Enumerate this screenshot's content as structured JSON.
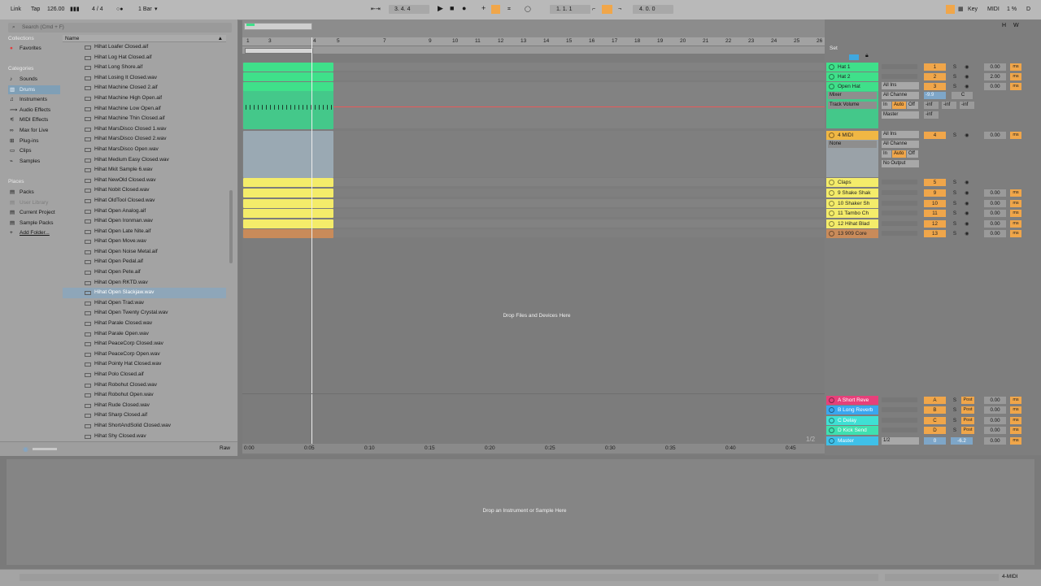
{
  "transport": {
    "link": "Link",
    "tap": "Tap",
    "tempo": "126.00",
    "signature": "4 / 4",
    "quantize": "1 Bar",
    "position": "3.   4.   4",
    "loop_start": "1.   1.   1",
    "loop_length": "4.   0.   0",
    "key_label": "Key",
    "midi_label": "MIDI",
    "cpu": "1 %",
    "disk": "D"
  },
  "browser": {
    "search_placeholder": "Search (Cmd + F)",
    "collections_header": "Collections",
    "favorites": "Favorites",
    "categories_header": "Categories",
    "categories": [
      "Sounds",
      "Drums",
      "Instruments",
      "Audio Effects",
      "MIDI Effects",
      "Max for Live",
      "Plug-ins",
      "Clips",
      "Samples"
    ],
    "selected_category": "Drums",
    "places_header": "Places",
    "places": [
      "Packs",
      "User Library",
      "Current Project",
      "Sample Packs",
      "Add Folder..."
    ],
    "name_column": "Name",
    "files": [
      "Hihat Loafer Closed.aif",
      "Hihat Log Hat Closed.aif",
      "Hihat Long Shore.aif",
      "Hihat Losing It Closed.wav",
      "Hihat Machine Closed 2.aif",
      "Hihat Machine High Open.aif",
      "Hihat Machine Low Open.aif",
      "Hihat Machine Thin Closed.aif",
      "Hihat MarsDisco Closed 1.wav",
      "Hihat MarsDisco Closed 2.wav",
      "Hihat MarsDisco Open.wav",
      "Hihat Medium Easy Closed.wav",
      "Hihat Mkit Sample 6.wav",
      "Hihat NewOld Closed.wav",
      "Hihat Nobit Closed.wav",
      "Hihat OldTool Closed.wav",
      "Hihat Open Analog.aif",
      "Hihat Open Ironman.wav",
      "Hihat Open Late Nite.aif",
      "Hihat Open Move.wav",
      "Hihat Open Noise Metal.aif",
      "Hihat Open Pedal.aif",
      "Hihat Open Pete.aif",
      "Hihat Open RKTD.wav",
      "Hihat Open Slackjaw.wav",
      "Hihat Open Trad.wav",
      "Hihat Open Twenty Crystal.wav",
      "Hihat Parale Closed.wav",
      "Hihat Parale Open.wav",
      "Hihat PeaceCorp Closed.wav",
      "Hihat PeaceCorp Open.wav",
      "Hihat Pointy Hat Closed.wav",
      "Hihat Polo Closed.aif",
      "Hihat Robohut Closed.wav",
      "Hihat Robohut Open.wav",
      "Hihat Rude Closed.wav",
      "Hihat Sharp Closed.aif",
      "Hihat ShortAndSolid Closed.wav",
      "Hihat Shy Closed.wav"
    ],
    "selected_file": "Hihat Open Slackjaw.wav",
    "raw_label": "Raw"
  },
  "arrangement": {
    "bar_numbers": [
      "1",
      "3",
      "4",
      "5",
      "7",
      "9",
      "10",
      "11",
      "12",
      "13",
      "14",
      "15",
      "16",
      "17",
      "18",
      "19",
      "20",
      "21",
      "22",
      "23",
      "24",
      "25",
      "26"
    ],
    "time_labels": [
      "0:00",
      "0:05",
      "0:10",
      "0:15",
      "0:20",
      "0:25",
      "0:30",
      "0:35",
      "0:40",
      "0:45"
    ],
    "drop_files": "Drop Files and Devices Here",
    "page_indicator": "1/2"
  },
  "set_label": "Set",
  "tracks": [
    {
      "name": "Hat 1",
      "color": "#3fe08a",
      "num": "1",
      "vol": "0.00"
    },
    {
      "name": "Hat 2",
      "color": "#3fe08a",
      "num": "2",
      "vol": "2.00"
    },
    {
      "name": "Open Hat",
      "color": "#3fe08a",
      "num": "3",
      "vol": "0.00",
      "io": [
        "All Ins",
        "All Channe",
        "Master"
      ],
      "sub": [
        "Mixer",
        "Track Volume"
      ],
      "vol_db": "-9.9",
      "pan": "C"
    },
    {
      "name": "4 MIDI",
      "color": "#f0b744",
      "num": "4",
      "vol": "0.00",
      "io": [
        "All Ins",
        "All Channe",
        "No Output"
      ],
      "sub": [
        "None"
      ]
    },
    {
      "name": "Claps",
      "color": "#f4ec6a",
      "num": "5",
      "vol": ""
    },
    {
      "name": "9 Shake Shak",
      "color": "#f4ec6a",
      "num": "9",
      "vol": "0.00"
    },
    {
      "name": "10 Shaker Sh",
      "color": "#f4ec6a",
      "num": "10",
      "vol": "0.00"
    },
    {
      "name": "11 Tambo Ch",
      "color": "#f4ec6a",
      "num": "11",
      "vol": "0.00"
    },
    {
      "name": "12 Hihat Blad",
      "color": "#f4ec6a",
      "num": "12",
      "vol": "0.00"
    },
    {
      "name": "13 909 Core",
      "color": "#c98b5a",
      "num": "13",
      "vol": "0.00"
    }
  ],
  "io_labels": {
    "in": "In",
    "auto": "Auto",
    "off": "Off",
    "inf": "-inf",
    "ms": "ms",
    "post": "Post",
    "s": "S"
  },
  "returns": [
    {
      "name": "A Short Reve",
      "color": "#e7407a",
      "letter": "A",
      "vol": "0.00"
    },
    {
      "name": "B Long Reverb",
      "color": "#3aa7ef",
      "letter": "B",
      "vol": "0.00"
    },
    {
      "name": "C Delay",
      "color": "#3fe0d4",
      "letter": "C",
      "vol": "0.00"
    },
    {
      "name": "D Kick Send",
      "color": "#3fe0b0",
      "letter": "D",
      "vol": "0.00"
    }
  ],
  "master": {
    "name": "Master",
    "color": "#3fc0e8",
    "routing": "1/2",
    "num": "0",
    "db": "-6.2",
    "vol": "0.00"
  },
  "detail": {
    "drop_instrument": "Drop an Instrument or Sample Here"
  },
  "status": {
    "track": "4-MIDI"
  }
}
